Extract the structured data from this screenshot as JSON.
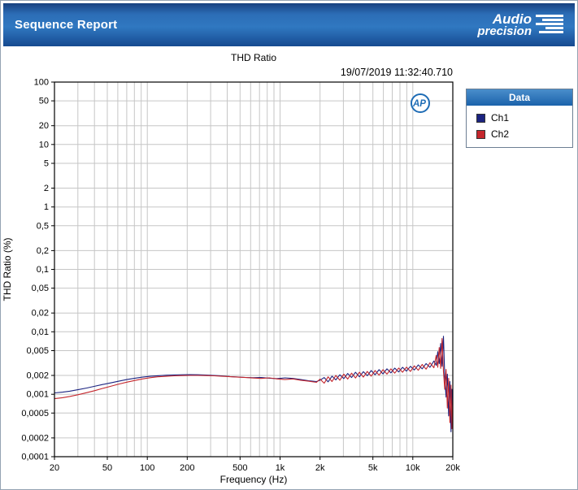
{
  "header": {
    "title": "Sequence Report",
    "logo_line1": "Audio",
    "logo_line2": "precision"
  },
  "report": {
    "timestamp": "19/07/2019 11:32:40.710",
    "ap_badge": "AP"
  },
  "legend": {
    "title": "Data"
  },
  "colors": {
    "header_blue": "#2c6db6",
    "legend_header_blue": "#1b62ab",
    "grid": "#c6c6c6",
    "plot_border": "#000000",
    "ap_badge_blue": "#1e6cb5",
    "ch1": "#1b2380",
    "ch2": "#c4262c"
  },
  "chart_data": {
    "type": "line",
    "title": "THD Ratio",
    "xlabel": "Frequency (Hz)",
    "ylabel": "THD Ratio (%)",
    "xscale": "log",
    "yscale": "log",
    "xlim": [
      20,
      20000
    ],
    "ylim": [
      0.0001,
      100
    ],
    "grid": true,
    "legend_position": "right",
    "x_ticks": [
      {
        "value": 20,
        "label": "20"
      },
      {
        "value": 50,
        "label": "50"
      },
      {
        "value": 100,
        "label": "100"
      },
      {
        "value": 200,
        "label": "200"
      },
      {
        "value": 500,
        "label": "500"
      },
      {
        "value": 1000,
        "label": "1k"
      },
      {
        "value": 2000,
        "label": "2k"
      },
      {
        "value": 5000,
        "label": "5k"
      },
      {
        "value": 10000,
        "label": "10k"
      },
      {
        "value": 20000,
        "label": "20k"
      }
    ],
    "y_ticks": [
      {
        "value": 100,
        "label": "100"
      },
      {
        "value": 50,
        "label": "50"
      },
      {
        "value": 20,
        "label": "20"
      },
      {
        "value": 10,
        "label": "10"
      },
      {
        "value": 5,
        "label": "5"
      },
      {
        "value": 2,
        "label": "2"
      },
      {
        "value": 1,
        "label": "1"
      },
      {
        "value": 0.5,
        "label": "0,5"
      },
      {
        "value": 0.2,
        "label": "0,2"
      },
      {
        "value": 0.1,
        "label": "0,1"
      },
      {
        "value": 0.05,
        "label": "0,05"
      },
      {
        "value": 0.02,
        "label": "0,02"
      },
      {
        "value": 0.01,
        "label": "0,01"
      },
      {
        "value": 0.005,
        "label": "0,005"
      },
      {
        "value": 0.002,
        "label": "0,002"
      },
      {
        "value": 0.001,
        "label": "0,001"
      },
      {
        "value": 0.0005,
        "label": "0,0005"
      },
      {
        "value": 0.0002,
        "label": "0,0002"
      },
      {
        "value": 0.0001,
        "label": "0,0001"
      }
    ],
    "x": [
      20,
      23,
      26,
      30,
      35,
      40,
      46,
      53,
      60,
      70,
      80,
      92,
      105,
      120,
      140,
      160,
      185,
      210,
      240,
      280,
      320,
      370,
      420,
      480,
      550,
      630,
      720,
      830,
      950,
      1090,
      1250,
      1430,
      1640,
      1880,
      2000,
      2150,
      2300,
      2460,
      2630,
      2820,
      3020,
      3230,
      3460,
      3700,
      3960,
      4240,
      4540,
      4860,
      5200,
      5570,
      5960,
      6380,
      6830,
      7310,
      7820,
      8370,
      8960,
      9590,
      10260,
      10980,
      11750,
      12580,
      13460,
      14400,
      15000,
      15400,
      15800,
      16200,
      16600,
      17000,
      17400,
      17800,
      18200,
      18600,
      19000,
      19400,
      19700,
      20000
    ],
    "series": [
      {
        "name": "Ch1",
        "color": "#1b2380",
        "values": [
          0.00105,
          0.00108,
          0.00112,
          0.00118,
          0.00126,
          0.00134,
          0.00143,
          0.00152,
          0.00161,
          0.00172,
          0.0018,
          0.00188,
          0.00194,
          0.00198,
          0.00202,
          0.00204,
          0.00205,
          0.00206,
          0.00205,
          0.00203,
          0.002,
          0.00196,
          0.00192,
          0.00189,
          0.00186,
          0.00184,
          0.00186,
          0.00181,
          0.00178,
          0.00183,
          0.00179,
          0.00172,
          0.00165,
          0.0016,
          0.00168,
          0.00185,
          0.00158,
          0.00195,
          0.0017,
          0.00205,
          0.00178,
          0.00215,
          0.00185,
          0.00225,
          0.0019,
          0.0023,
          0.00198,
          0.0024,
          0.00205,
          0.00248,
          0.00212,
          0.00255,
          0.0022,
          0.00262,
          0.00228,
          0.0027,
          0.00235,
          0.0028,
          0.00245,
          0.00295,
          0.00255,
          0.0031,
          0.0027,
          0.0034,
          0.0029,
          0.0048,
          0.0031,
          0.0065,
          0.0028,
          0.0085,
          0.0019,
          0.0009,
          0.0021,
          0.00045,
          0.0016,
          0.00025,
          0.0012,
          0.0005
        ]
      },
      {
        "name": "Ch2",
        "color": "#c4262c",
        "values": [
          0.00085,
          0.00088,
          0.00092,
          0.00098,
          0.00106,
          0.00114,
          0.00124,
          0.00134,
          0.00144,
          0.00156,
          0.00166,
          0.00176,
          0.00184,
          0.0019,
          0.00194,
          0.00197,
          0.00199,
          0.002,
          0.002,
          0.00199,
          0.00197,
          0.00194,
          0.00191,
          0.00188,
          0.00185,
          0.00182,
          0.00179,
          0.00183,
          0.00176,
          0.00172,
          0.00176,
          0.00168,
          0.00162,
          0.00155,
          0.00175,
          0.0015,
          0.0019,
          0.0016,
          0.002,
          0.00168,
          0.0021,
          0.00175,
          0.00218,
          0.00182,
          0.00225,
          0.00188,
          0.00232,
          0.00195,
          0.0024,
          0.00202,
          0.00248,
          0.0021,
          0.00255,
          0.00218,
          0.00263,
          0.00225,
          0.00272,
          0.00232,
          0.00285,
          0.00242,
          0.003,
          0.00252,
          0.0032,
          0.00265,
          0.0042,
          0.0027,
          0.0056,
          0.0026,
          0.0078,
          0.0023,
          0.0012,
          0.0025,
          0.0006,
          0.0018,
          0.00035,
          0.0014,
          0.00028,
          0.0009
        ]
      }
    ]
  }
}
